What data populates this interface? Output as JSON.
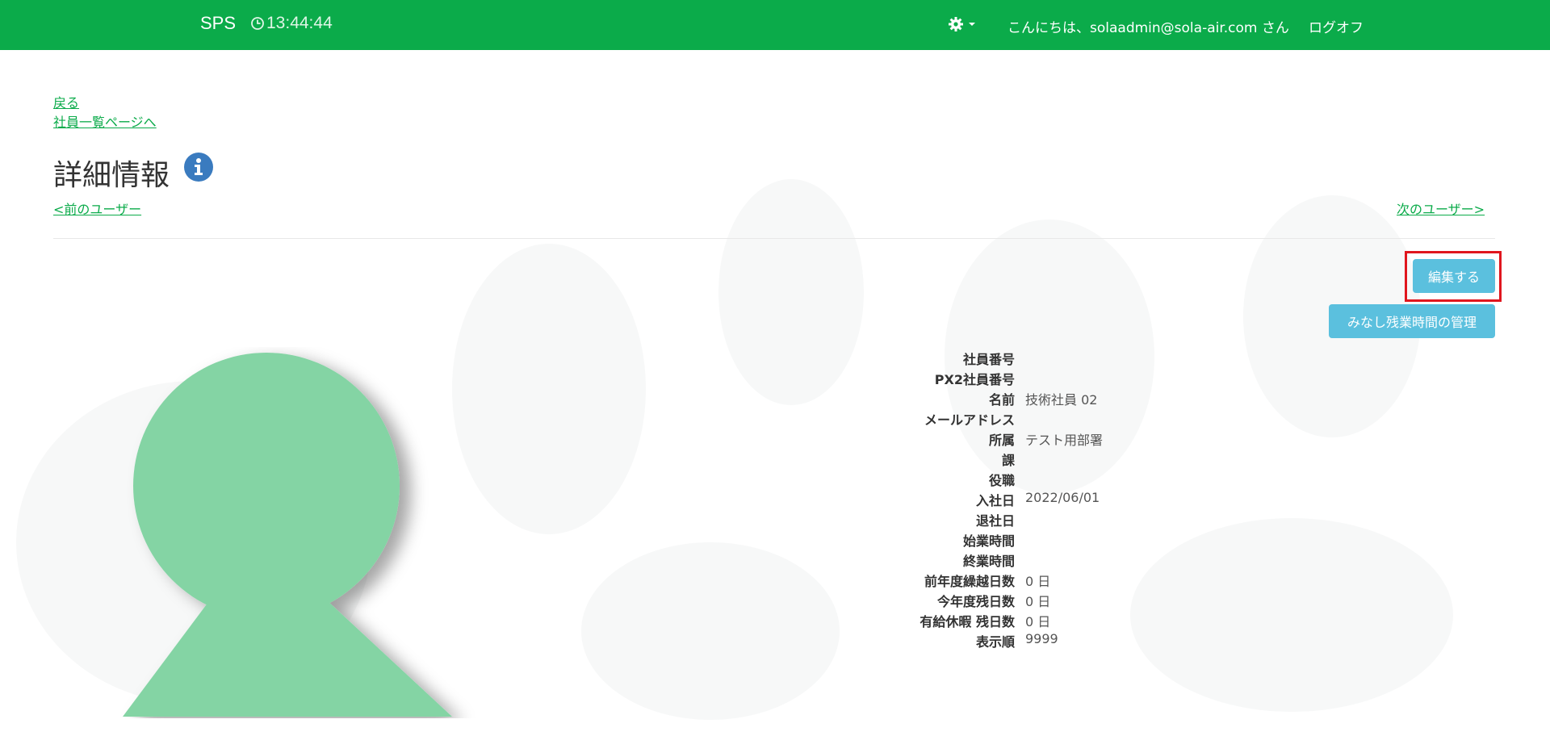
{
  "header": {
    "brand": "SPS",
    "clock": "13:44:44",
    "greeting": "こんにちは、solaadmin@sola-air.com さん",
    "logoff_label": "ログオフ",
    "settings_icon": "gear-icon",
    "color": "#0bab4a"
  },
  "nav": {
    "back_label": "戻る",
    "employee_list_label": "社員一覧ページへ",
    "prev_user_label": "<前のユーザー",
    "next_user_label": "次のユーザー>"
  },
  "page": {
    "title": "詳細情報",
    "title_icon": "info-icon"
  },
  "actions": {
    "edit_label": "編集する",
    "overtime_label": "みなし残業時間の管理",
    "button_color": "#5bc0de"
  },
  "details": [
    {
      "label": "社員番号",
      "value": ""
    },
    {
      "label": "PX2社員番号",
      "value": ""
    },
    {
      "label": "名前",
      "value": "技術社員 02"
    },
    {
      "label": "メールアドレス",
      "value": ""
    },
    {
      "label": "所属",
      "value": "テスト用部署"
    },
    {
      "label": "課",
      "value": ""
    },
    {
      "label": "役職",
      "value": ""
    },
    {
      "label": "入社日",
      "value": "2022/06/01"
    },
    {
      "label": "退社日",
      "value": ""
    },
    {
      "label": "始業時間",
      "value": ""
    },
    {
      "label": "終業時間",
      "value": ""
    },
    {
      "label": "前年度繰越日数",
      "value": "0 日"
    },
    {
      "label": "今年度残日数",
      "value": "0 日"
    },
    {
      "label": "有給休暇 残日数",
      "value": "0 日"
    },
    {
      "label": "表示順",
      "value": "9999"
    }
  ]
}
